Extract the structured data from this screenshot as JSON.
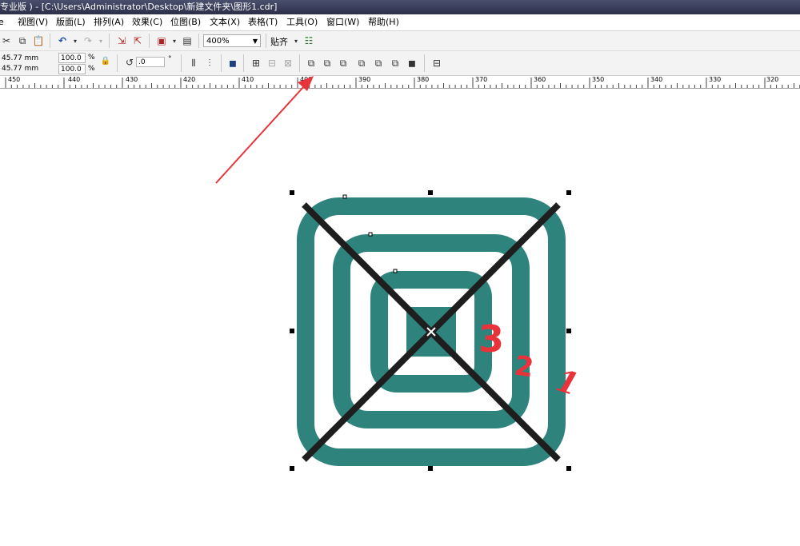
{
  "window": {
    "title": "专业版 ) - [C:\\Users\\Administrator\\Desktop\\新建文件夹\\图形1.cdr]"
  },
  "menu": [
    "视图(V)",
    "版面(L)",
    "排列(A)",
    "效果(C)",
    "位图(B)",
    "文本(X)",
    "表格(T)",
    "工具(O)",
    "窗口(W)",
    "帮助(H)"
  ],
  "toolbar": {
    "zoom_value": "400%",
    "snap_label": "贴齐"
  },
  "property_bar": {
    "width_value": "45.77 mm",
    "height_value": "45.77 mm",
    "scale_x": "100.0",
    "scale_y": "100.0",
    "percent_symbol": "%",
    "rotation_value": ".0",
    "degree_symbol": "°"
  },
  "ruler": {
    "labels": [
      "450",
      "440",
      "430",
      "420",
      "410",
      "400",
      "390",
      "380",
      "370",
      "360",
      "350",
      "340",
      "330",
      "320"
    ]
  },
  "canvas": {
    "shape_color": "#2e837c",
    "cross_color": "#1e1e1e",
    "annotation_color": "#e8333a",
    "annotations": [
      "3",
      "2",
      "1"
    ]
  }
}
